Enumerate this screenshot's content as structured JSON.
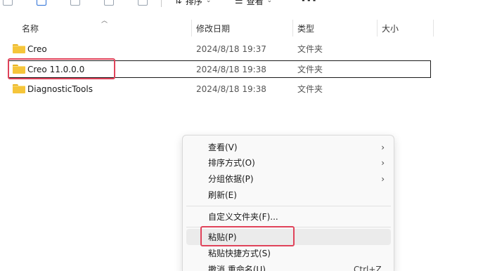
{
  "toolbar": {
    "sort_label": "排序",
    "view_label": "查看",
    "more_label": "···"
  },
  "columns": {
    "name": "名称",
    "date": "修改日期",
    "type": "类型",
    "size": "大小"
  },
  "files": [
    {
      "name": "Creo",
      "date": "2024/8/18 19:37",
      "type": "文件夹"
    },
    {
      "name": "Creo 11.0.0.0",
      "date": "2024/8/18 19:38",
      "type": "文件夹"
    },
    {
      "name": "DiagnosticTools",
      "date": "2024/8/18 19:38",
      "type": "文件夹"
    }
  ],
  "context_menu": {
    "view": "查看(V)",
    "sort_by": "排序方式(O)",
    "group_by": "分组依据(P)",
    "refresh": "刷新(E)",
    "customize": "自定义文件夹(F)...",
    "paste": "粘贴(P)",
    "paste_shortcut": "粘贴快捷方式(S)",
    "undo_rename": "撤消 重命名(U)",
    "undo_shortcut": "Ctrl+Z",
    "submenu_arrow": "›"
  },
  "colors": {
    "highlight_box": "#e0435a",
    "folder": "#f5c53a"
  }
}
